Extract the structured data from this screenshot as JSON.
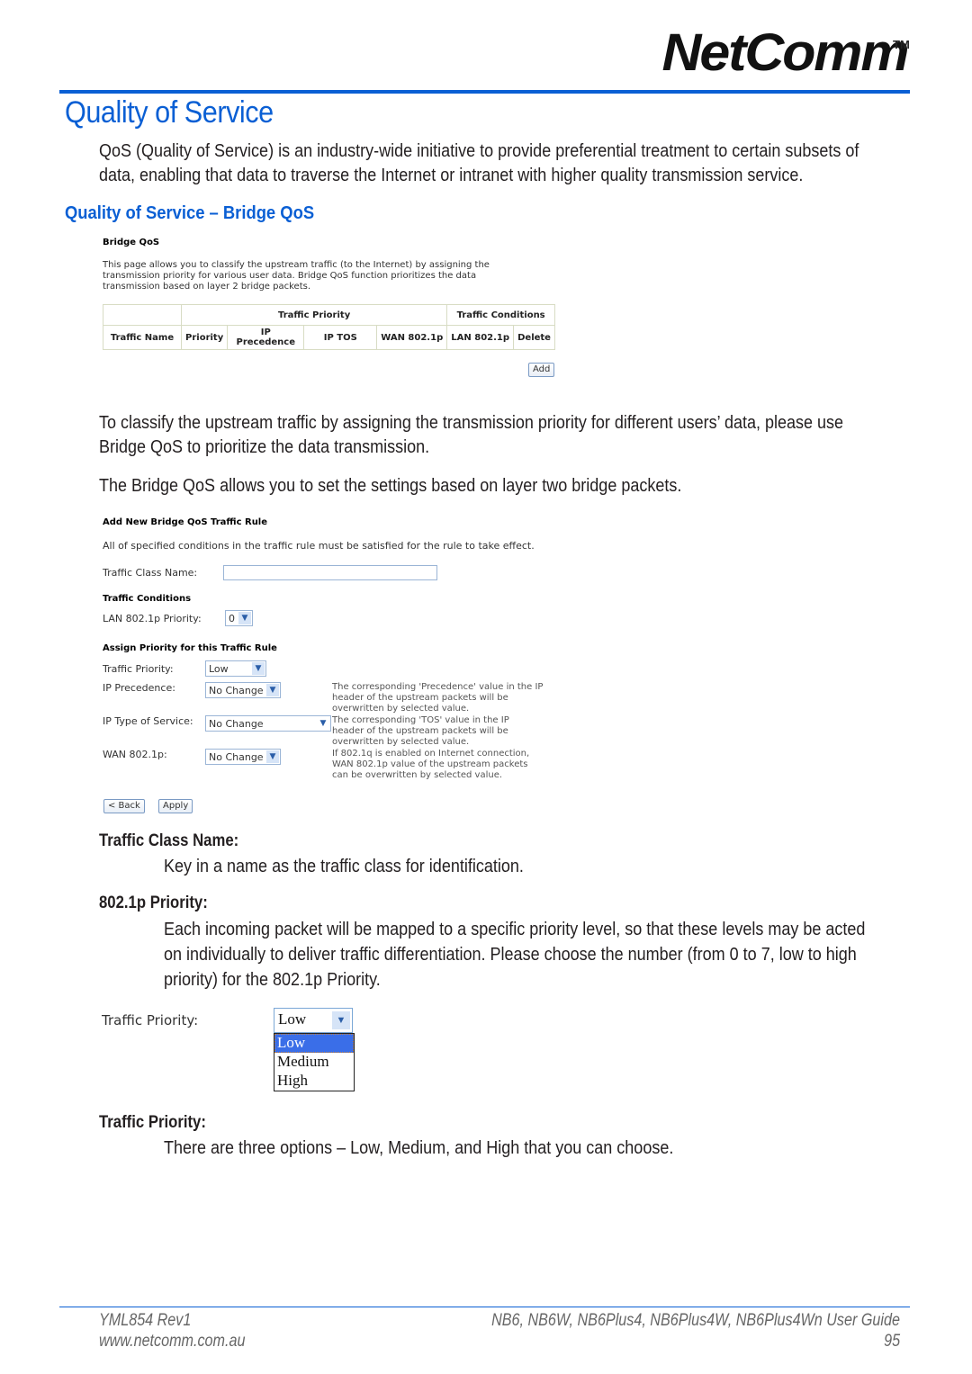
{
  "header": {
    "logo": "NetComm",
    "trademark": "TM"
  },
  "title": "Quality of Service",
  "intro": [
    "QoS (Quality of Service) is an industry-wide initiative to provide preferential treatment to certain subsets of",
    "data, enabling that data to traverse the Internet or intranet with higher quality transmission service."
  ],
  "subtitle": "Quality of Service – Bridge QoS",
  "screenshot1": {
    "heading": "Bridge QoS",
    "description": [
      "This page allows you to classify the upstream traffic (to the Internet) by assigning the",
      "transmission priority for various user data. Bridge QoS function prioritizes the data",
      "transmission based on layer 2 bridge packets."
    ],
    "table": {
      "group_headers": [
        "Traffic Priority",
        "Traffic Conditions"
      ],
      "columns": [
        "Traffic Name",
        "Priority",
        "IP Precedence",
        "IP TOS",
        "WAN 802.1p",
        "LAN 802.1p",
        "Delete"
      ],
      "rows": []
    },
    "add_button": "Add"
  },
  "para2": [
    "To classify the upstream traffic by assigning the transmission priority for different users’ data, please use",
    "Bridge QoS to prioritize the data transmission."
  ],
  "para3": "The Bridge QoS allows you to set the settings based on layer two bridge packets.",
  "screenshot2": {
    "heading": "Add New Bridge QoS Traffic Rule",
    "description": "All of specified conditions in the traffic rule must be satisfied for the rule to take effect.",
    "traffic_class_name_label": "Traffic Class Name:",
    "traffic_class_name_value": "",
    "conditions_heading": "Traffic Conditions",
    "lan_priority_label": "LAN 802.1p Priority:",
    "lan_priority_value": "0",
    "assign_heading": "Assign Priority for this Traffic Rule",
    "traffic_priority_label": "Traffic Priority:",
    "traffic_priority_value": "Low",
    "ip_precedence_label": "IP Precedence:",
    "ip_precedence_value": "No Change",
    "ip_precedence_note": [
      "The corresponding 'Precedence' value in the IP",
      "header of the upstream packets will be",
      "overwritten by selected value."
    ],
    "ip_tos_label": "IP Type of Service:",
    "ip_tos_value": "No Change",
    "ip_tos_note": [
      "The corresponding 'TOS' value in the IP",
      "header of the upstream packets will be",
      "overwritten by selected value."
    ],
    "wan_label": "WAN 802.1p:",
    "wan_value": "No Change",
    "wan_note": [
      "If 802.1q is enabled on Internet connection,",
      "WAN 802.1p value of the upstream packets",
      "can be overwritten by selected value."
    ],
    "back_button": "< Back",
    "apply_button": "Apply"
  },
  "defs": [
    {
      "term": "Traffic Class Name:",
      "desc": [
        "Key in a name as the traffic class for identification."
      ]
    },
    {
      "term": "802.1p Priority:",
      "desc": [
        "Each incoming packet will be mapped to a specific priority level, so that these levels may be acted",
        "on individually to deliver traffic differentiation. Please choose the number (from 0 to 7, low to high",
        "priority) for the 802.1p Priority."
      ]
    },
    {
      "term": "Traffic Priority:",
      "desc": [
        "There are three options – Low, Medium, and High that you can choose."
      ]
    }
  ],
  "screenshot3": {
    "label": "Traffic Priority:",
    "selected": "Low",
    "options": [
      "Low",
      "Medium",
      "High"
    ]
  },
  "footer": {
    "doc_id": "YML854 Rev1",
    "website": "www.netcomm.com.au",
    "guide": "NB6, NB6W, NB6Plus4, NB6Plus4W, NB6Plus4Wn User Guide",
    "page": "95"
  },
  "colors": {
    "accent": "#0a5fd4",
    "selected_option": "#3a6ee8"
  }
}
